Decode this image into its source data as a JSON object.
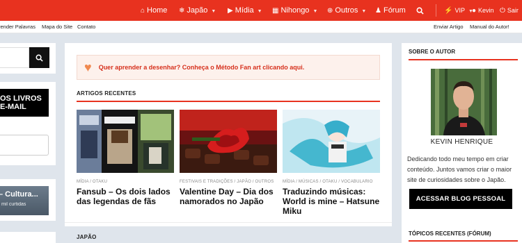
{
  "nav": {
    "home": "Home",
    "japao": "Japão",
    "midia": "Mídia",
    "nihongo": "Nihongo",
    "outros": "Outros",
    "forum": "Fórum",
    "vip": "VIP",
    "user": "Kevin",
    "logout": "Sair"
  },
  "subnav": {
    "left": [
      "render Palavras",
      "Mapa do Site",
      "Contato"
    ],
    "right": [
      "Enviar Artigo",
      "Manual do Autor!"
    ]
  },
  "left": {
    "promo_line1": "OS LIVROS",
    "promo_line2": "E-MAIL",
    "culture_title": "– Cultura...",
    "culture_sub": "mil curtidas"
  },
  "main": {
    "banner_text": "Quer aprender a desenhar? Conheça o Método Fan art clicando aqui.",
    "recent_title": "ARTIGOS RECENTES",
    "next_section": "JAPÃO",
    "posts": [
      {
        "category": "MÍDIA / OTAKU",
        "title": "Fansub – Os dois lados das legendas de fãs"
      },
      {
        "category": "FESTIVAIS E TRADIÇÕES / JAPÃO / OUTROS",
        "title": "Valentine Day – Dia dos namorados no Japão"
      },
      {
        "category": "MÍDIA / MÚSICAS / OTAKU / VOCABULARIO",
        "title": "Traduzindo músicas: World is mine – Hatsune Miku"
      }
    ]
  },
  "right": {
    "about_title": "SOBRE O AUTOR",
    "author_name": "KEVIN HENRIQUE",
    "bio": "Dedicando todo meu tempo em criar conteúdo. Juntos vamos criar o maior site de curiosidades sobre o Japão.",
    "blog_button": "ACESSAR BLOG PESSOAL",
    "topics_title": "TÓPICOS RECENTES (FÓRUM)"
  },
  "colors": {
    "brand_red": "#e8321f",
    "page_bg": "#dfe5ec",
    "banner_bg": "#fdf1ec"
  },
  "icons": [
    "home-icon",
    "snowflake-icon",
    "play-icon",
    "book-icon",
    "plus-circle-icon",
    "users-icon",
    "search-icon",
    "bolt-icon",
    "user-icon",
    "power-icon",
    "heart-icon"
  ]
}
